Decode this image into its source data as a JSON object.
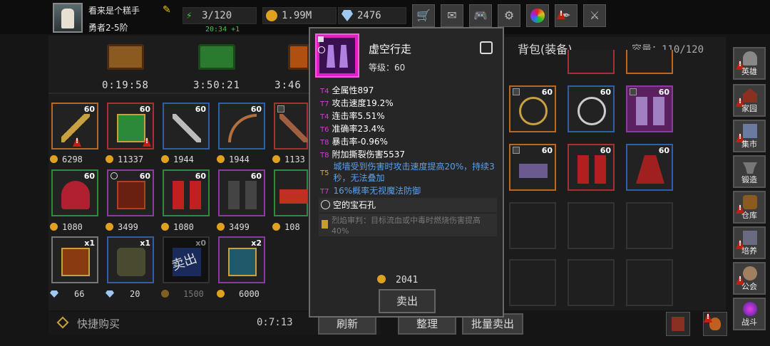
{
  "player": {
    "name": "看来是个糕手",
    "rank": "勇者2-5阶",
    "regen": "20:34 +1"
  },
  "resources": {
    "energy": "3/120",
    "gold": "1.99M",
    "gems": "2476"
  },
  "top_buttons": [
    "shop-icon",
    "mail-icon",
    "gamepad-icon",
    "gear-icon",
    "color-wheel-icon",
    "feather-icon",
    "sword-off-icon"
  ],
  "chests": [
    {
      "timer": "0:19:58"
    },
    {
      "timer": "3:50:21"
    },
    {
      "timer": "3:46"
    }
  ],
  "shop_items": [
    {
      "lvl": "60",
      "price": "6298",
      "rarity": "orange"
    },
    {
      "lvl": "60",
      "price": "11337",
      "rarity": "red"
    },
    {
      "lvl": "60",
      "price": "1944",
      "rarity": "blue"
    },
    {
      "lvl": "60",
      "price": "1944",
      "rarity": "blue"
    },
    {
      "lvl": "",
      "price": "1133",
      "rarity": "red"
    },
    {
      "lvl": "60",
      "price": "1080",
      "rarity": "green"
    },
    {
      "lvl": "60",
      "price": "3499",
      "rarity": "purple"
    },
    {
      "lvl": "60",
      "price": "1080",
      "rarity": "green"
    },
    {
      "lvl": "60",
      "price": "3499",
      "rarity": "purple"
    },
    {
      "lvl": "",
      "price": "108",
      "rarity": "green"
    },
    {
      "lvl": "x1",
      "price": "66",
      "rarity": "gray",
      "currency": "gem"
    },
    {
      "lvl": "x1",
      "price": "20",
      "rarity": "blue",
      "currency": "gem"
    },
    {
      "lvl": "x0",
      "price": "1500",
      "rarity": "dark",
      "overlay": "卖出"
    },
    {
      "lvl": "x2",
      "price": "6000",
      "rarity": "purple"
    }
  ],
  "shop_footer": {
    "quick_buy": "快捷购买",
    "timer": "0:7:13",
    "refresh": "刷新"
  },
  "bag": {
    "title": "背包(装备)",
    "capacity_label": "容量：110/120",
    "sort": "整理",
    "bulk_sell": "批量卖出",
    "items": [
      {
        "lvl": "60"
      },
      {
        "lvl": "60"
      },
      {
        "lvl": "60"
      },
      {
        "lvl": "60"
      },
      {
        "lvl": "60"
      },
      {
        "lvl": "60"
      }
    ]
  },
  "side_nav": [
    "英雄",
    "家园",
    "集市",
    "锻造",
    "仓库",
    "培养",
    "公会",
    "战斗"
  ],
  "tooltip": {
    "name": "虚空行走",
    "level": "等级：60",
    "attrs": [
      {
        "tier": "T4",
        "text": "全属性897"
      },
      {
        "tier": "T7",
        "text": "攻击速度19.2%"
      },
      {
        "tier": "T4",
        "text": "连击率5.51%"
      },
      {
        "tier": "T6",
        "text": "准确率23.4%"
      },
      {
        "tier": "T8",
        "text": "暴击率-0.96%"
      },
      {
        "tier": "T8",
        "text": "附加撕裂伤害5537"
      }
    ],
    "special1_tier": "T5",
    "special1": "城墙受到伤害时攻击速度提高20%，持续3秒，无法叠加",
    "special2_tier": "T7",
    "special2": "16%概率无视魔法防御",
    "gem_slot": "空的宝石孔",
    "set_text": "烈焰审判：目标流血或中毒时燃烧伤害提高40%",
    "price": "2041",
    "sell": "卖出"
  },
  "colors": {
    "orange": "#b86820",
    "red": "#a83030",
    "blue": "#2f5fa8",
    "green": "#2f8a3f",
    "purple": "#8a3aa0",
    "tooltip_bg": "#262626",
    "special_text": "#5aa0e8"
  }
}
